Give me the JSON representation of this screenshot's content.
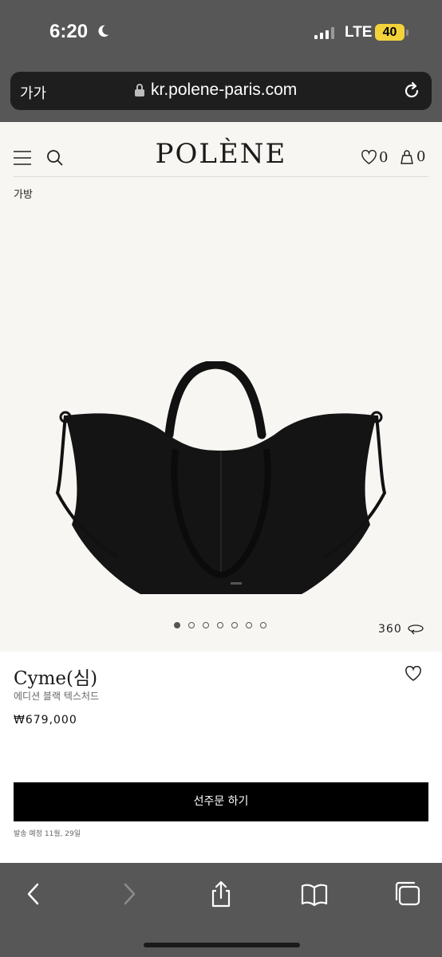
{
  "status": {
    "time": "6:20",
    "network": "LTE",
    "battery": "40"
  },
  "browser": {
    "text_size": "가가",
    "url": "kr.polene-paris.com"
  },
  "nav": {
    "logo": "POLÈNE",
    "wishlist_count": "0",
    "cart_count": "0"
  },
  "breadcrumb": "가방",
  "gallery": {
    "total": 7,
    "active": 1,
    "view_360": "360"
  },
  "product": {
    "name": "Cyme(심)",
    "subtitle": "에디션 블랙 텍스처드",
    "price": "₩679,000",
    "cta": "선주문 하기",
    "shipping": "발송 예정 11월, 29일"
  },
  "colors": {
    "page_bg": "#f7f6f3",
    "chrome": "#575757",
    "battery": "#f4d33a",
    "cta_bg": "#000000"
  }
}
